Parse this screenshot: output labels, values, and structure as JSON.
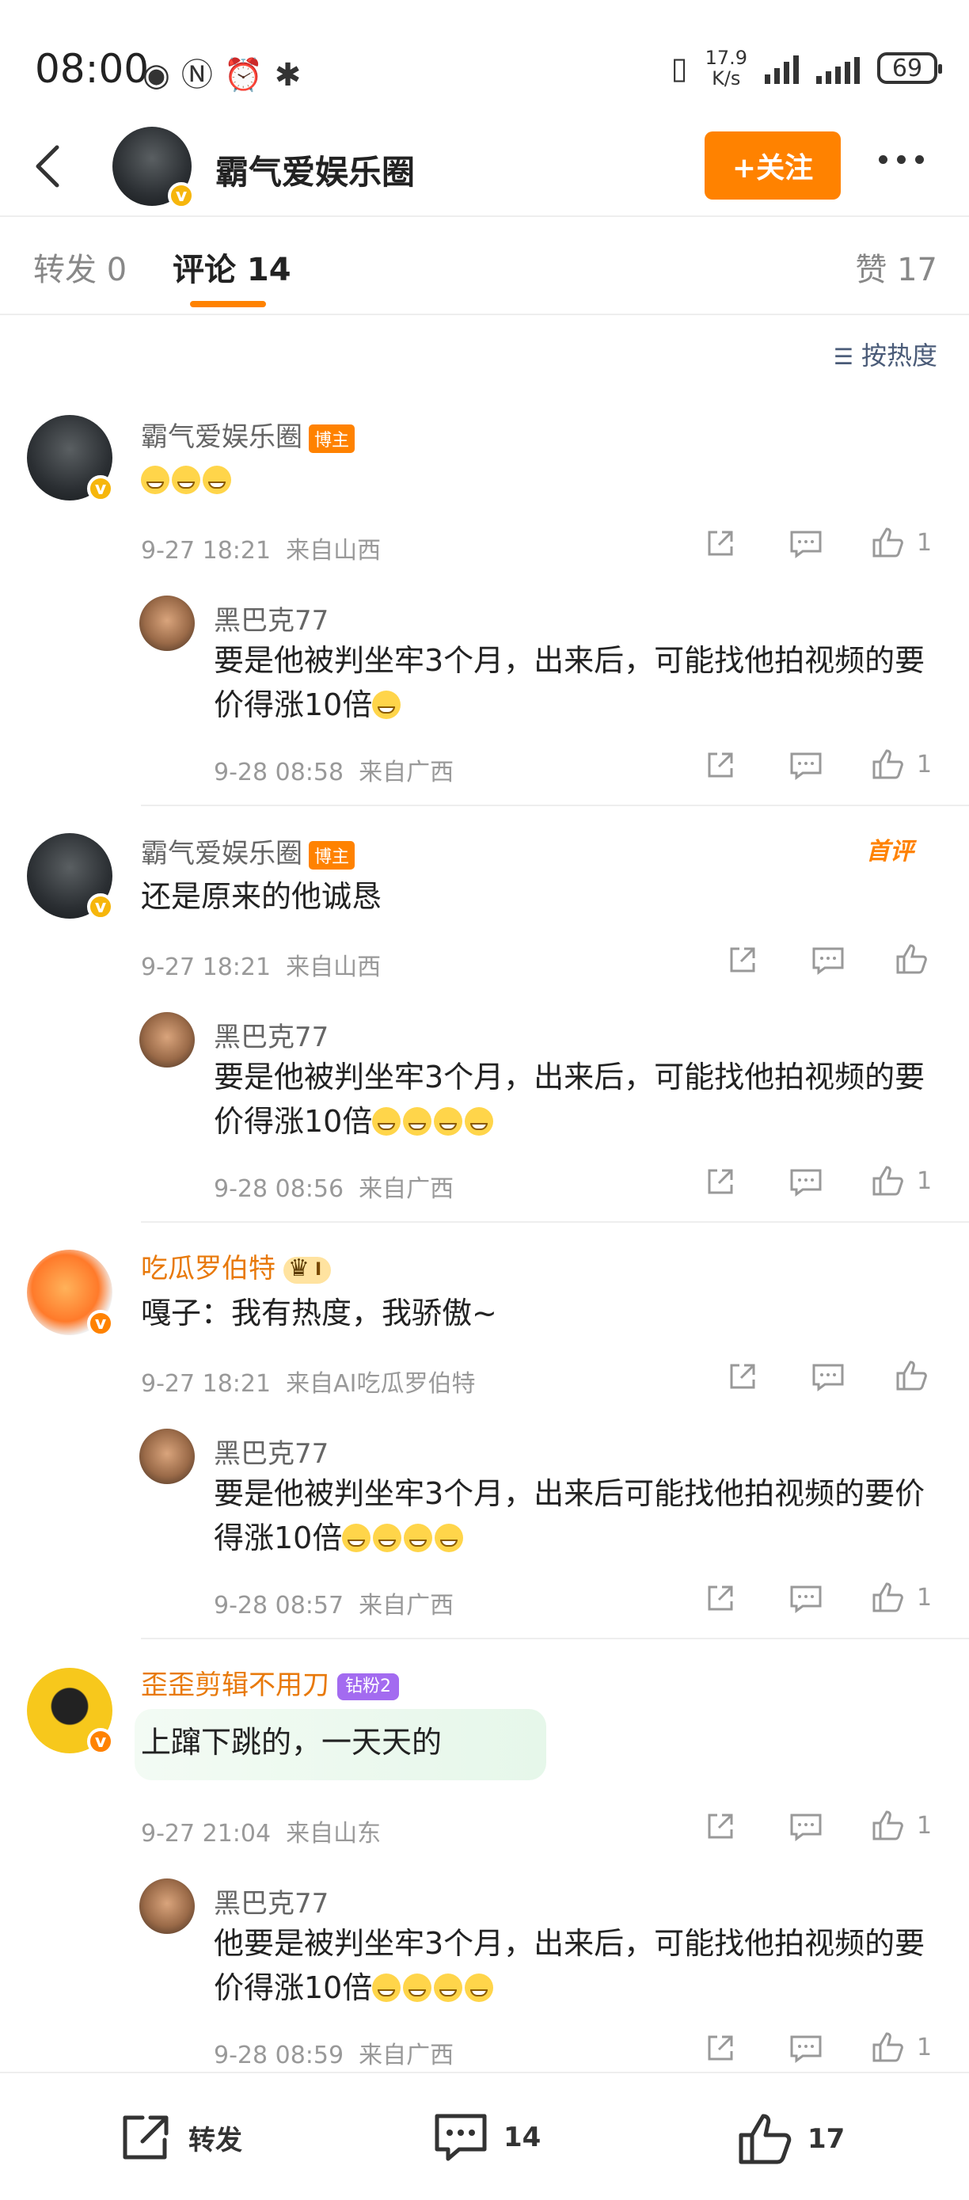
{
  "status_bar": {
    "time": "08:00",
    "net_speed": "17.9",
    "net_unit": "K/s",
    "battery": "69"
  },
  "header": {
    "account_name": "霸气爱娱乐圈",
    "follow_label": "+关注"
  },
  "tabs": [
    {
      "label": "转发 0"
    },
    {
      "label": "评论 14"
    },
    {
      "label": "赞 17"
    }
  ],
  "sort_label": "按热度",
  "host_badge": "博主",
  "first_comment_tag": "首评",
  "comments": [
    {
      "name": "霸气爱娱乐圈",
      "text": "",
      "time": "9-27 18:21",
      "location": "来自山西",
      "likes": "1",
      "reply": {
        "name": "黑巴克77",
        "text": "要是他被判坐牢3个月，出来后，可能找他拍视频的要价得涨10倍",
        "time": "9-28 08:58",
        "location": "来自广西",
        "likes": "1"
      }
    },
    {
      "name": "霸气爱娱乐圈",
      "text": "还是原来的他诚恳",
      "time": "9-27 18:21",
      "location": "来自山西",
      "likes": "",
      "reply": {
        "name": "黑巴克77",
        "text": "要是他被判坐牢3个月，出来后，可能找他拍视频的要价得涨10倍",
        "time": "9-28 08:56",
        "location": "来自广西",
        "likes": "1"
      }
    },
    {
      "name": "吃瓜罗伯特",
      "level": "I",
      "text": "嘎子：我有热度，我骄傲~",
      "time": "9-27 18:21",
      "location": "来自AI吃瓜罗伯特",
      "likes": "",
      "reply": {
        "name": "黑巴克77",
        "text": "要是他被判坐牢3个月，出来后可能找他拍视频的要价得涨10倍",
        "time": "9-28 08:57",
        "location": "来自广西",
        "likes": "1"
      }
    },
    {
      "name": "歪歪剪辑不用刀",
      "fan_badge": "钻粉2",
      "text": "上蹿下跳的，一天天的",
      "time": "9-27 21:04",
      "location": "来自山东",
      "likes": "1",
      "reply": {
        "name": "黑巴克77",
        "text": "他要是被判坐牢3个月，出来后，可能找他拍视频的要价得涨10倍",
        "time": "9-28 08:59",
        "location": "来自广西",
        "likes": "1"
      }
    }
  ],
  "bottom_bar": {
    "repost_label": "转发",
    "comment_count": "14",
    "like_count": "17"
  }
}
